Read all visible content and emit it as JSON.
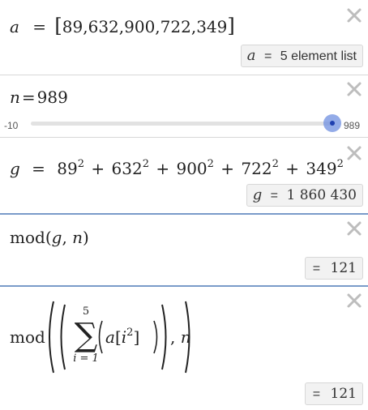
{
  "rows": {
    "a": {
      "var": "a",
      "eq": "=",
      "list_text": "89,632,900,722,349",
      "result_var": "a",
      "result_eq": "=",
      "result_text": "5 element list"
    },
    "n": {
      "var": "n",
      "eq": "=",
      "value_text": "989",
      "slider_min": "-10",
      "slider_max": "989",
      "slider_fraction": 1.0
    },
    "g": {
      "var": "g",
      "eq": "=",
      "terms": [
        {
          "base": "89",
          "exp": "2"
        },
        {
          "base": "632",
          "exp": "2"
        },
        {
          "base": "900",
          "exp": "2"
        },
        {
          "base": "722",
          "exp": "2"
        },
        {
          "base": "349",
          "exp": "2"
        }
      ],
      "plus": "+",
      "result_var": "g",
      "result_eq": "=",
      "result_value": "1 860 430"
    },
    "mod1": {
      "fn": "mod",
      "arg1": "g",
      "arg2": "n",
      "result_eq": "=",
      "result_value": "121"
    },
    "mod2": {
      "fn": "mod",
      "sum_upper": "5",
      "sum_lower": "i = 1",
      "sum_symbol": "∑",
      "list_var": "a",
      "index_var": "i",
      "exp": "2",
      "arg2": "n",
      "result_eq": "=",
      "result_value": "121"
    }
  },
  "icons": {
    "close": "close-x-icon"
  },
  "colors": {
    "slider_knob": "#1e3fb0",
    "slider_halo": "#6f8fe0",
    "active_separator": "#7a9bc9"
  }
}
